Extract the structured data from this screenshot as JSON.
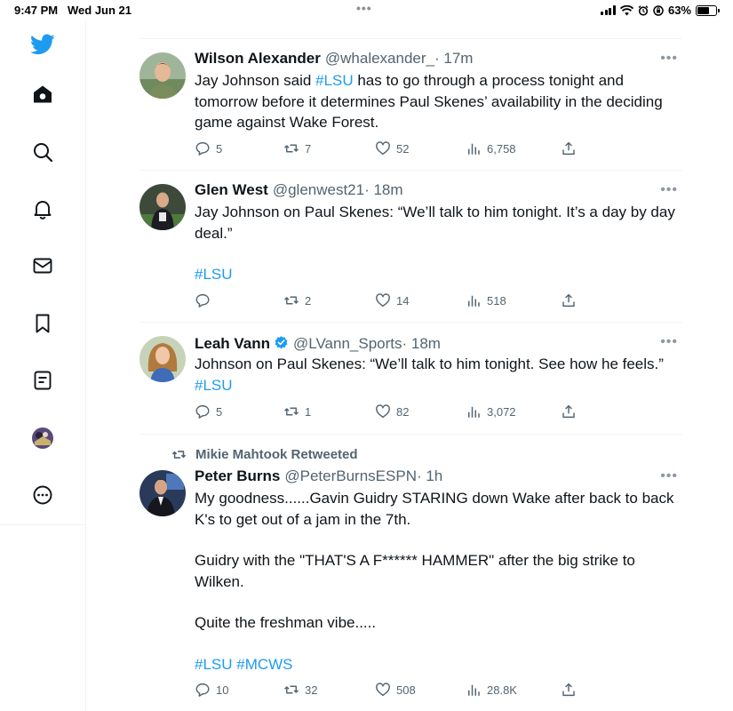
{
  "status_bar": {
    "time": "9:47 PM",
    "date": "Wed Jun 21",
    "battery": "63%",
    "battery_level": 0.63
  },
  "sidebar": {
    "items": [
      {
        "name": "twitter-logo-icon"
      },
      {
        "name": "home-icon"
      },
      {
        "name": "search-icon"
      },
      {
        "name": "notifications-bell-icon"
      },
      {
        "name": "messages-envelope-icon"
      },
      {
        "name": "bookmark-icon"
      },
      {
        "name": "lists-icon"
      },
      {
        "name": "profile-avatar"
      },
      {
        "name": "more-options-icon"
      }
    ]
  },
  "tweets": [
    {
      "name": "Wilson Alexander",
      "handle": "@whalexander_",
      "time": "· 17m",
      "body_parts": [
        "Jay Johnson said ",
        "#LSU",
        " has to go through a process tonight and tomorrow before it determines Paul Skenes’ availability in the deciding game against Wake Forest."
      ],
      "replies": "5",
      "retweets": "7",
      "likes": "52",
      "views": "6,758"
    },
    {
      "name": "Glen West",
      "handle": "@glenwest21",
      "time": "· 18m",
      "body_text": "Jay Johnson on Paul Skenes: “We’ll talk to him tonight. It’s a day by day deal.”",
      "hashtag": "#LSU",
      "replies": "",
      "retweets": "2",
      "likes": "14",
      "views": "518"
    },
    {
      "name": "Leah Vann",
      "handle": "@LVann_Sports",
      "time": "· 18m",
      "body_text": "Johnson on Paul Skenes: “We’ll talk to him tonight. See how he feels.”",
      "hashtag": "#LSU",
      "replies": "5",
      "retweets": "1",
      "likes": "82",
      "views": "3,072"
    },
    {
      "retweeted_by": "Mikie Mahtook Retweeted",
      "name": "Peter Burns",
      "handle": "@PeterBurnsESPN",
      "time": "· 1h",
      "paragraphs": [
        "My goodness......Gavin Guidry STARING down Wake after back to back K's to get out of a jam in the 7th.",
        "Guidry with the \"THAT'S A F****** HAMMER\" after the big strike to Wilken.",
        "Quite the freshman vibe....."
      ],
      "hashtags": "#LSU #MCWS",
      "replies": "10",
      "retweets": "32",
      "likes": "508",
      "views": "28.8K"
    }
  ],
  "colors": {
    "brand": "#1d9bf0",
    "text": "#0f1419",
    "secondary": "#536471",
    "divider": "#eff3f4"
  }
}
